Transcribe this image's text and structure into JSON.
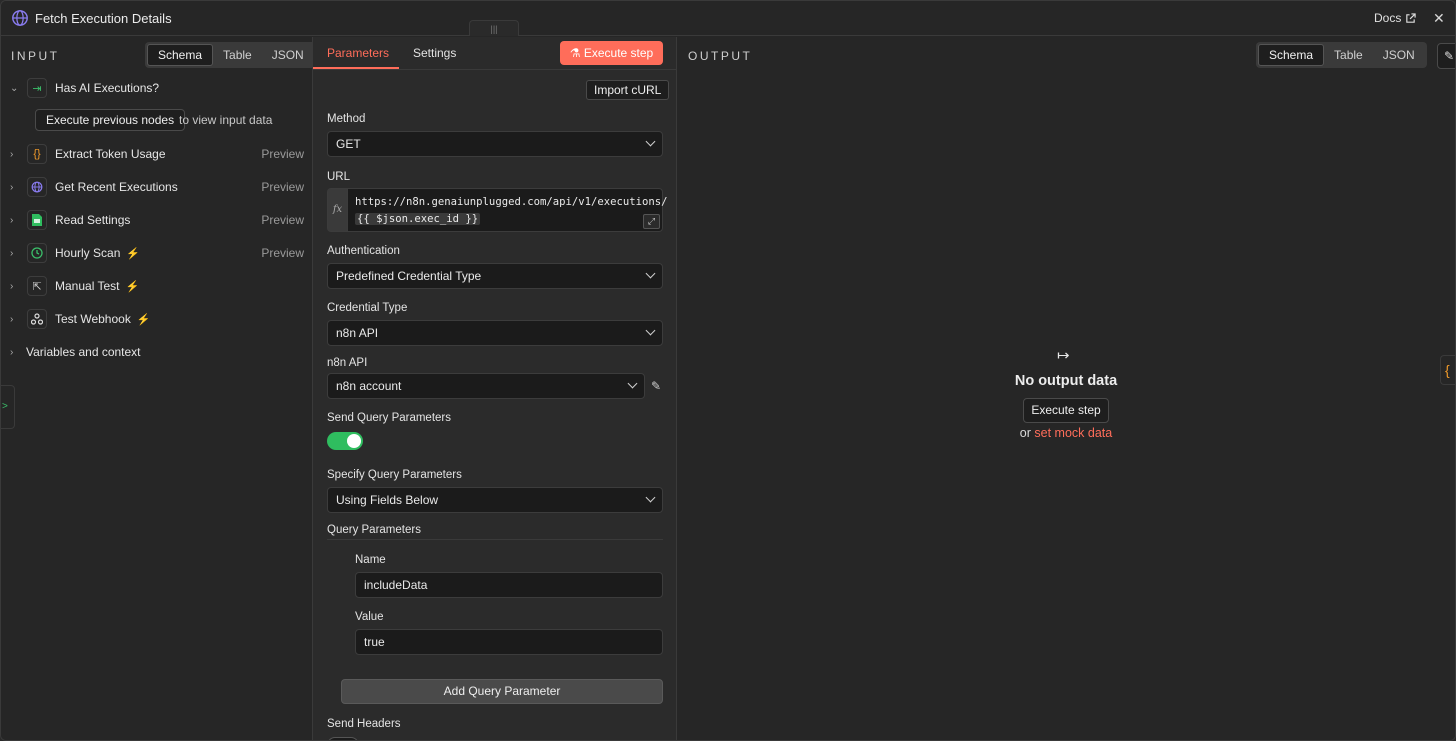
{
  "window": {
    "title": "Fetch Execution Details",
    "docs_label": "Docs"
  },
  "input": {
    "label": "INPUT",
    "view_tabs": [
      "Schema",
      "Table",
      "JSON"
    ],
    "active_tab": "Schema",
    "nodes": [
      {
        "name": "Has AI Executions?",
        "icon": "signpost-icon",
        "expanded": true,
        "preview": ""
      },
      {
        "name": "Extract Token Usage",
        "icon": "code-braces-icon",
        "preview": "Preview"
      },
      {
        "name": "Get Recent Executions",
        "icon": "globe-icon",
        "preview": "Preview"
      },
      {
        "name": "Read Settings",
        "icon": "sheet-icon",
        "preview": "Preview"
      },
      {
        "name": "Hourly Scan",
        "icon": "clock-icon",
        "trigger": true,
        "preview": "Preview"
      },
      {
        "name": "Manual Test",
        "icon": "cursor-icon",
        "trigger": true,
        "preview": ""
      },
      {
        "name": "Test Webhook",
        "icon": "webhook-icon",
        "trigger": true,
        "preview": ""
      }
    ],
    "execute_previous_label": "Execute previous nodes",
    "execute_previous_hint": "to view input data",
    "variables_label": "Variables and context"
  },
  "params": {
    "tabs": [
      "Parameters",
      "Settings"
    ],
    "active_tab": "Parameters",
    "execute_step_label": "Execute step",
    "import_curl_label": "Import cURL",
    "method": {
      "label": "Method",
      "value": "GET"
    },
    "url": {
      "label": "URL",
      "text": "https://n8n.genaiunplugged.com/api/v1/executions/",
      "expression": "{{ $json.exec_id }}"
    },
    "authentication": {
      "label": "Authentication",
      "value": "Predefined Credential Type"
    },
    "credential_type": {
      "label": "Credential Type",
      "value": "n8n API"
    },
    "n8n_api": {
      "label": "n8n API",
      "value": "n8n account"
    },
    "send_query": {
      "label": "Send Query Parameters",
      "on": true
    },
    "specify_query": {
      "label": "Specify Query Parameters",
      "value": "Using Fields Below"
    },
    "query_parameters": {
      "title": "Query Parameters",
      "name_label": "Name",
      "name_value": "includeData",
      "value_label": "Value",
      "value_value": "true",
      "add_label": "Add Query Parameter"
    },
    "send_headers": {
      "label": "Send Headers",
      "on": false
    }
  },
  "output": {
    "label": "OUTPUT",
    "view_tabs": [
      "Schema",
      "Table",
      "JSON"
    ],
    "active_tab": "Schema",
    "empty_title": "No output data",
    "execute_step_label": "Execute step",
    "or_label": "or",
    "mock_label": "set mock data"
  },
  "colors": {
    "accent": "#ff6d5a",
    "toggle_on": "#2fbd5f",
    "trigger_bolt": "#ff5a4a"
  }
}
